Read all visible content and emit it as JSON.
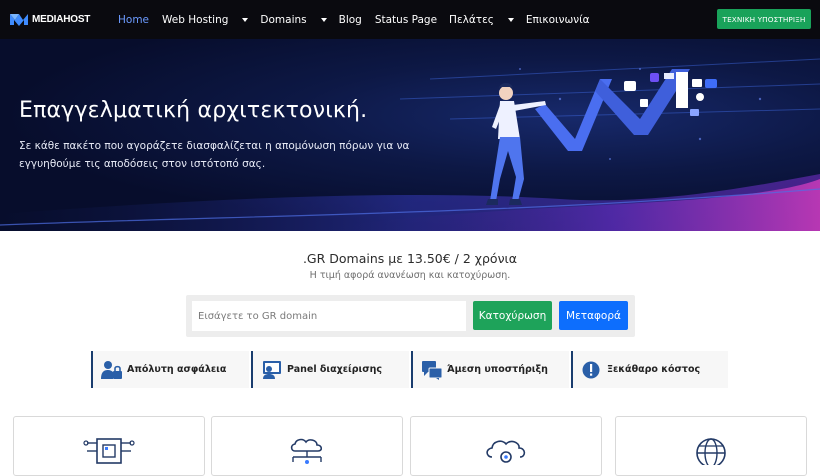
{
  "brand": {
    "name": "MEDIAHOST"
  },
  "nav": {
    "items": [
      {
        "label": "Home",
        "active": true,
        "dropdown": false
      },
      {
        "label": "Web Hosting",
        "active": false,
        "dropdown": true
      },
      {
        "label": "Domains",
        "active": false,
        "dropdown": true
      },
      {
        "label": "Blog",
        "active": false,
        "dropdown": false
      },
      {
        "label": "Status Page",
        "active": false,
        "dropdown": false
      },
      {
        "label": "Πελάτες",
        "active": false,
        "dropdown": true
      },
      {
        "label": "Επικοινωνία",
        "active": false,
        "dropdown": false
      }
    ],
    "support_button": "ΤΕΧΝΙΚΗ ΥΠΟΣΤΗΡΙΞΗ"
  },
  "hero": {
    "title": "Επαγγελματική αρχιτεκτονική.",
    "subtitle": "Σε κάθε πακέτο που αγοράζετε διασφαλίζεται η απομόνωση πόρων για να εγγυηθούμε τις αποδόσεις στον ιστότοπό σας."
  },
  "domain": {
    "title": ".GR Domains με 13.50€ / 2 χρόνια",
    "subtitle": "Η τιμή αφορά ανανέωση και κατοχύρωση.",
    "placeholder": "Εισάγετε το GR domain",
    "register_label": "Κατοχύρωση",
    "transfer_label": "Μεταφορά"
  },
  "features": [
    {
      "label": "Απόλυτη ασφάλεια",
      "icon": "user-lock-icon"
    },
    {
      "label": "Panel διαχείρισης",
      "icon": "panel-icon"
    },
    {
      "label": "Άμεση υποστήριξη",
      "icon": "support-icon"
    },
    {
      "label": "Ξεκάθαρο κόστος",
      "icon": "exclamation-icon"
    }
  ],
  "cards": [
    {
      "icon": "cpu-chip-icon"
    },
    {
      "icon": "cloud-network-icon"
    },
    {
      "icon": "cloud-settings-icon"
    },
    {
      "icon": "globe-icon"
    }
  ],
  "colors": {
    "accent_green": "#1ea35a",
    "accent_blue": "#0d6efd",
    "nav_active": "#6c9bff",
    "nav_bg": "#0a0a0f",
    "hero_bg": "#0d1845"
  }
}
